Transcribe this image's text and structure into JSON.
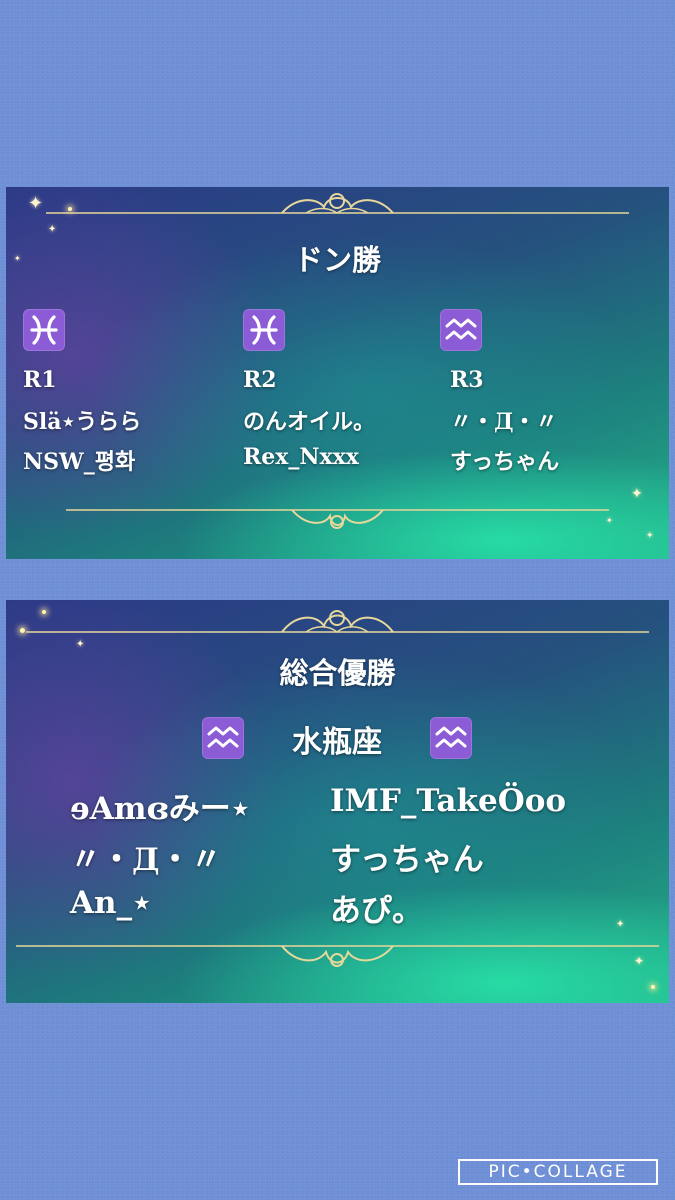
{
  "card1": {
    "title": "ドン勝",
    "columns": [
      {
        "zodiac_icon": "pisces-icon",
        "round": "R1",
        "names": [
          "Slä⋆うらら",
          "NSW_평화"
        ]
      },
      {
        "zodiac_icon": "pisces-icon",
        "round": "R2",
        "names": [
          "のんオイル。",
          "Rex_Nxxx"
        ]
      },
      {
        "zodiac_icon": "aquarius-icon",
        "round": "R3",
        "names": [
          "〃・Д・〃",
          "すっちゃん"
        ]
      }
    ]
  },
  "card2": {
    "title": "総合優勝",
    "team": "水瓶座",
    "team_icon": "aquarius-icon",
    "members": [
      "ɘAmɞみー⋆",
      "IMF_TakeÖoo",
      "〃・Д・〃",
      "すっちゃん",
      "An_⋆",
      "あぴ。"
    ]
  },
  "watermark": "PIC•COLLAGE",
  "colors": {
    "background": "#6f8fd6",
    "zodiac_tile": "#8c5bd6",
    "gold": "#e8d79a"
  }
}
